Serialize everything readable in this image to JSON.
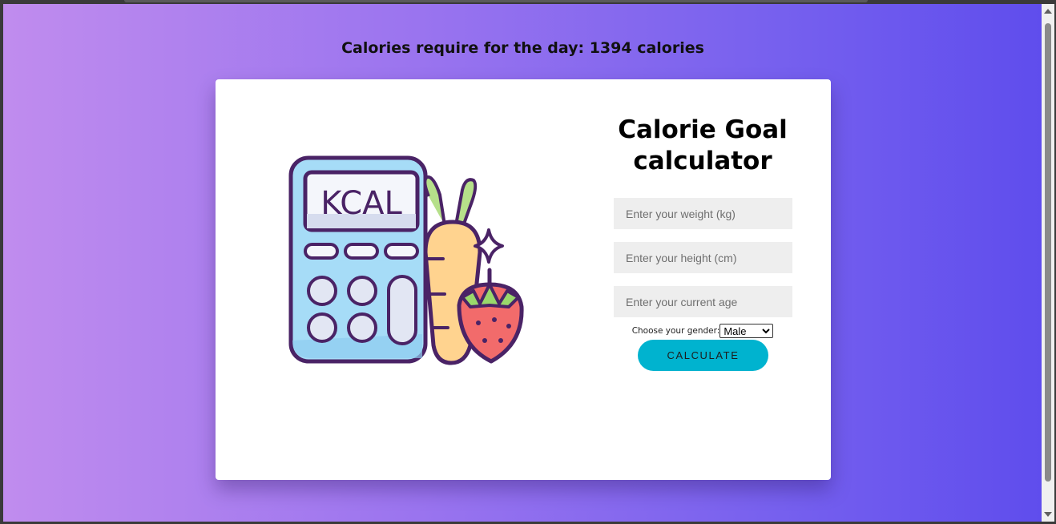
{
  "result": {
    "text": "Calories require for the day: 1394 calories"
  },
  "card": {
    "title": "Calorie Goal calculator",
    "illustration_label": "KCAL",
    "weight_input": {
      "placeholder": "Enter your weight (kg)",
      "value": ""
    },
    "height_input": {
      "placeholder": "Enter your height (cm)",
      "value": ""
    },
    "age_input": {
      "placeholder": "Enter your current age",
      "value": ""
    },
    "gender": {
      "label": "Choose your gender:",
      "selected": "Male"
    },
    "calculate_label": "CALCULATE"
  },
  "colors": {
    "gradient_start": "#c08cee",
    "gradient_end": "#5f4ded",
    "button": "#00b3cf",
    "input_background": "#eeeeee"
  }
}
